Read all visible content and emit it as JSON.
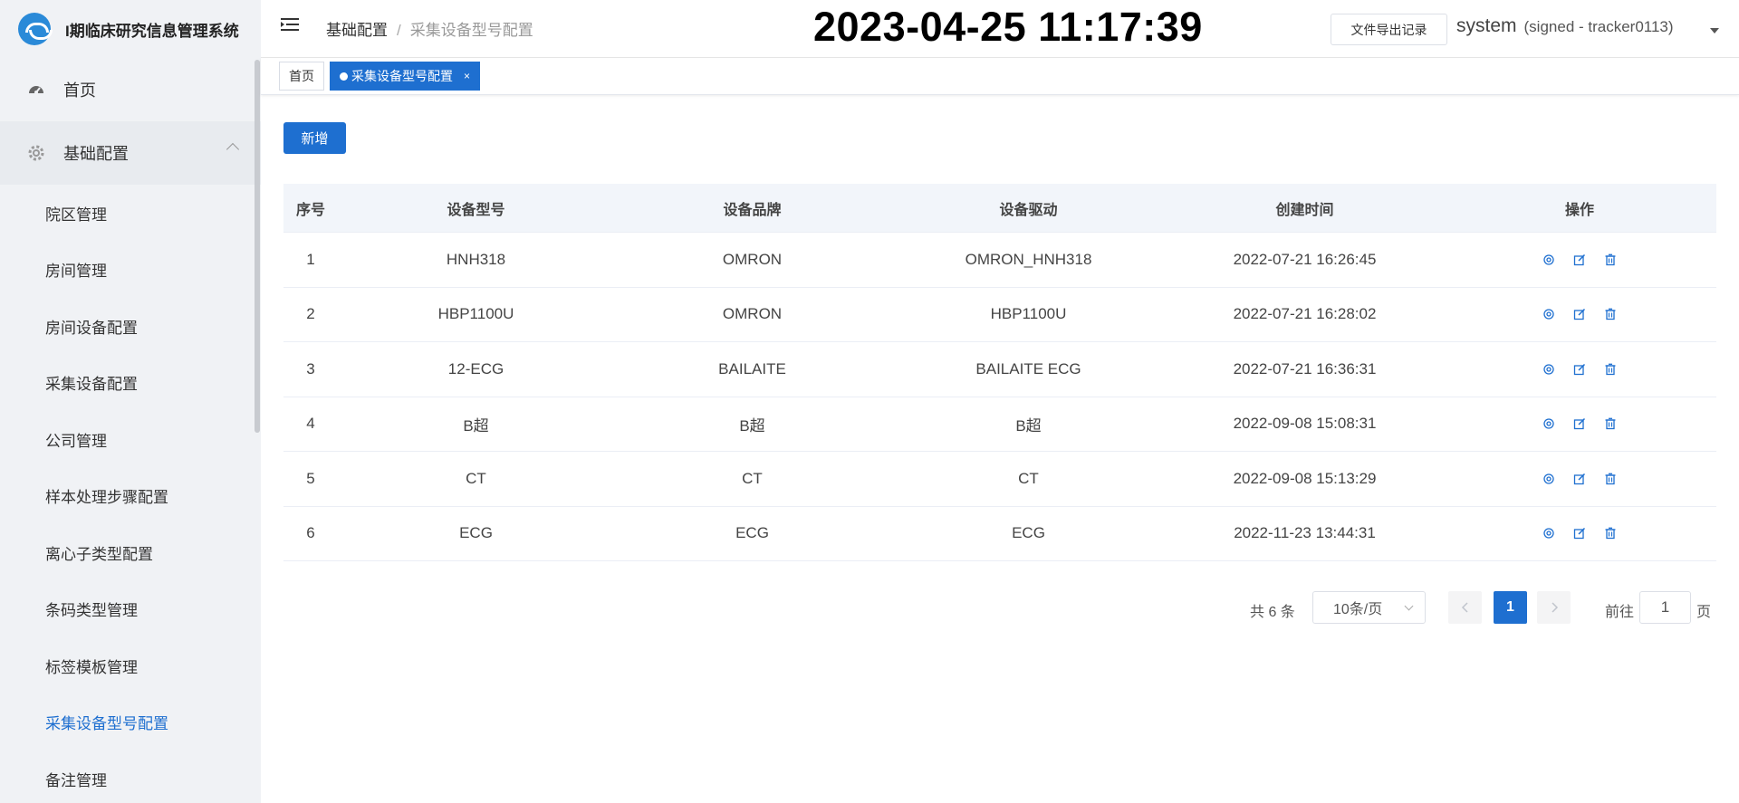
{
  "app": {
    "title": "I期临床研究信息管理系统"
  },
  "sidebar": {
    "home_label": "首页",
    "group_label": "基础配置",
    "items": [
      {
        "label": "院区管理",
        "active": false
      },
      {
        "label": "房间管理",
        "active": false
      },
      {
        "label": "房间设备配置",
        "active": false
      },
      {
        "label": "采集设备配置",
        "active": false
      },
      {
        "label": "公司管理",
        "active": false
      },
      {
        "label": "样本处理步骤配置",
        "active": false
      },
      {
        "label": "离心子类型配置",
        "active": false
      },
      {
        "label": "条码类型管理",
        "active": false
      },
      {
        "label": "标签模板管理",
        "active": false
      },
      {
        "label": "采集设备型号配置",
        "active": true
      },
      {
        "label": "备注管理",
        "active": false
      }
    ]
  },
  "header": {
    "breadcrumb": [
      "基础配置",
      "采集设备型号配置"
    ],
    "breadcrumb_sep": "/",
    "clock": "2023-04-25 11:17:39",
    "export_label": "文件导出记录",
    "user_name": "system",
    "user_sub": "(signed - tracker0113)"
  },
  "tags": {
    "home": "首页",
    "active": "采集设备型号配置",
    "close": "×"
  },
  "toolbar": {
    "add_label": "新增"
  },
  "table": {
    "headers": [
      "序号",
      "设备型号",
      "设备品牌",
      "设备驱动",
      "创建时间",
      "操作"
    ],
    "rows": [
      [
        "1",
        "HNH318",
        "OMRON",
        "OMRON_HNH318",
        "2022-07-21 16:26:45"
      ],
      [
        "2",
        "HBP1100U",
        "OMRON",
        "HBP1100U",
        "2022-07-21 16:28:02"
      ],
      [
        "3",
        "12-ECG",
        "BAILAITE",
        "BAILAITE ECG",
        "2022-07-21 16:36:31"
      ],
      [
        "4",
        "B超",
        "B超",
        "B超",
        "2022-09-08 15:08:31"
      ],
      [
        "5",
        "CT",
        "CT",
        "CT",
        "2022-09-08 15:13:29"
      ],
      [
        "6",
        "ECG",
        "ECG",
        "ECG",
        "2022-11-23 13:44:31"
      ]
    ]
  },
  "pagination": {
    "total_text": "共 6 条",
    "page_size": "10条/页",
    "current_page": "1",
    "goto_label": "前往",
    "goto_value": "1",
    "goto_unit": "页"
  },
  "colors": {
    "accent": "#1e6fd0",
    "sidebar_bg": "#f0f2f5",
    "header_row_bg": "#f2f5fa"
  }
}
